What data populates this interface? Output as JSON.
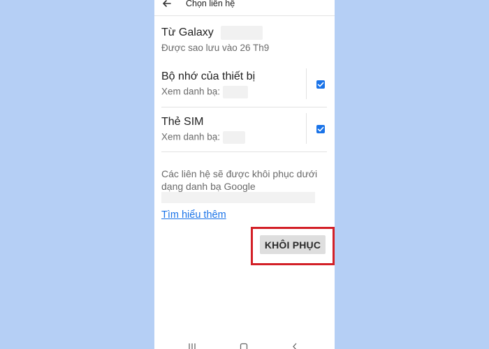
{
  "appbar": {
    "title": "Chọn liên hệ"
  },
  "source": {
    "title": "Từ Galaxy",
    "subtitle": "Được sao lưu vào 26 Th9"
  },
  "options": [
    {
      "title": "Bộ nhớ của thiết bị",
      "subtitle": "Xem danh bạ:",
      "checked": true
    },
    {
      "title": "Thẻ SIM",
      "subtitle": "Xem danh bạ:",
      "checked": true
    }
  ],
  "info": {
    "text": "Các liên hệ sẽ được khôi phục dưới dạng danh bạ Google",
    "link": "Tìm hiểu thêm"
  },
  "actions": {
    "restore_label": "KHÔI PHỤC"
  },
  "colors": {
    "background": "#b5cff5",
    "accent": "#1a73e8",
    "highlight": "#d32027"
  },
  "icons": {
    "back": "arrow-left",
    "checkbox": "checkmark",
    "nav_recents": "three-bars",
    "nav_home": "rounded-square",
    "nav_back": "chevron-left"
  }
}
